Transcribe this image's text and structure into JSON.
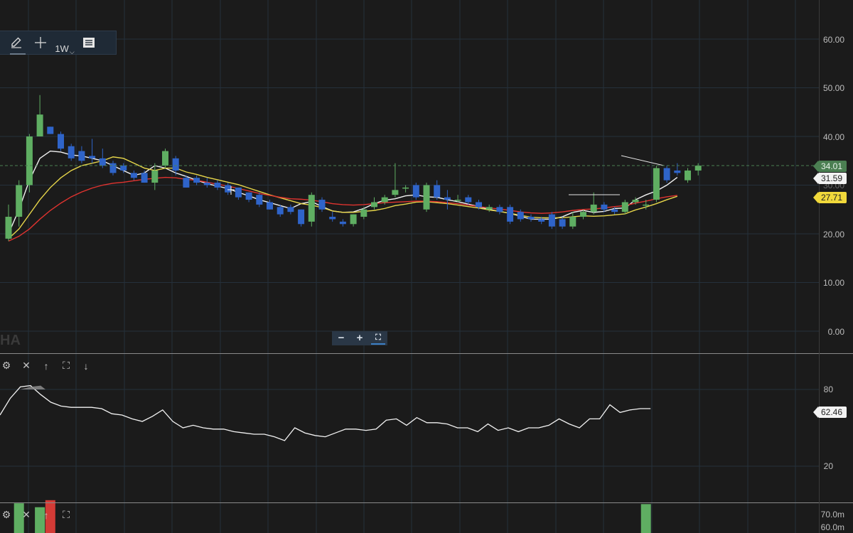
{
  "toolbar": {
    "timeframe": "1W",
    "icons": [
      "pencil-icon",
      "crosshair-icon",
      "chevron-down-icon",
      "list-icon"
    ]
  },
  "zoom": {
    "minus": "−",
    "plus": "+",
    "fit": "⛶"
  },
  "symbol_watermark": "HA",
  "panels": {
    "rsi_tools": [
      "gear-icon",
      "close-icon",
      "arrow-up-icon",
      "expand-icon",
      "arrow-down-icon"
    ],
    "volume_tools": [
      "gear-icon",
      "close-icon",
      "arrow-up-icon",
      "expand-icon"
    ]
  },
  "price_tags": {
    "last": "34.01",
    "white": "31.59",
    "yellow": "27.71",
    "rsi": "62.46"
  },
  "colors": {
    "up": "#5fae62",
    "down": "#2f64c9",
    "sma_white": "#f2f2f2",
    "sma_yellow": "#e7d64a",
    "sma_red": "#e0332f",
    "grid": "#25303b",
    "last_line": "#4b7f52"
  },
  "chart_data": [
    {
      "type": "candlestick",
      "title": "",
      "timeframe": "1W",
      "y_ticks": [
        "60.00",
        "50.00",
        "40.00",
        "30.00",
        "20.00",
        "10.00",
        "0.00"
      ],
      "ylim": [
        -3,
        73
      ],
      "last_price": 34.01,
      "candles": [
        {
          "o": 19.0,
          "h": 26.0,
          "l": 18.5,
          "c": 23.5
        },
        {
          "o": 23.5,
          "h": 31.0,
          "l": 21.5,
          "c": 30.0
        },
        {
          "o": 30.0,
          "h": 40.5,
          "l": 28.5,
          "c": 40.0
        },
        {
          "o": 40.0,
          "h": 48.5,
          "l": 42.0,
          "c": 44.5
        },
        {
          "o": 42.0,
          "h": 42.0,
          "l": 40.5,
          "c": 40.5
        },
        {
          "o": 40.5,
          "h": 41.0,
          "l": 37.0,
          "c": 37.5
        },
        {
          "o": 38.0,
          "h": 38.5,
          "l": 35.0,
          "c": 35.5
        },
        {
          "o": 37.0,
          "h": 38.0,
          "l": 34.5,
          "c": 35.0
        },
        {
          "o": 36.0,
          "h": 39.5,
          "l": 34.5,
          "c": 35.5
        },
        {
          "o": 35.5,
          "h": 37.5,
          "l": 33.5,
          "c": 34.0
        },
        {
          "o": 34.5,
          "h": 35.0,
          "l": 32.0,
          "c": 32.5
        },
        {
          "o": 34.0,
          "h": 34.5,
          "l": 32.5,
          "c": 33.0
        },
        {
          "o": 32.5,
          "h": 33.0,
          "l": 31.0,
          "c": 31.5
        },
        {
          "o": 32.5,
          "h": 33.0,
          "l": 30.5,
          "c": 30.5
        },
        {
          "o": 30.5,
          "h": 34.5,
          "l": 29.0,
          "c": 33.0
        },
        {
          "o": 34.0,
          "h": 37.5,
          "l": 33.5,
          "c": 37.0
        },
        {
          "o": 35.5,
          "h": 36.0,
          "l": 32.0,
          "c": 33.0
        },
        {
          "o": 31.5,
          "h": 32.0,
          "l": 29.5,
          "c": 29.5
        },
        {
          "o": 31.5,
          "h": 32.0,
          "l": 30.0,
          "c": 30.5
        },
        {
          "o": 30.5,
          "h": 31.5,
          "l": 29.5,
          "c": 30.0
        },
        {
          "o": 30.5,
          "h": 31.0,
          "l": 29.0,
          "c": 29.5
        },
        {
          "o": 30.0,
          "h": 30.5,
          "l": 28.0,
          "c": 28.5
        },
        {
          "o": 29.5,
          "h": 29.5,
          "l": 27.0,
          "c": 27.5
        },
        {
          "o": 28.5,
          "h": 28.5,
          "l": 26.5,
          "c": 27.0
        },
        {
          "o": 28.0,
          "h": 28.5,
          "l": 25.5,
          "c": 26.0
        },
        {
          "o": 26.5,
          "h": 27.0,
          "l": 25.0,
          "c": 25.0
        },
        {
          "o": 25.5,
          "h": 26.0,
          "l": 23.5,
          "c": 24.0
        },
        {
          "o": 25.5,
          "h": 26.0,
          "l": 24.0,
          "c": 24.5
        },
        {
          "o": 25.0,
          "h": 25.0,
          "l": 21.5,
          "c": 22.0
        },
        {
          "o": 22.5,
          "h": 28.5,
          "l": 21.5,
          "c": 28.0
        },
        {
          "o": 27.0,
          "h": 27.5,
          "l": 24.5,
          "c": 25.0
        },
        {
          "o": 23.5,
          "h": 24.5,
          "l": 22.5,
          "c": 23.0
        },
        {
          "o": 22.5,
          "h": 23.0,
          "l": 21.5,
          "c": 22.0
        },
        {
          "o": 22.0,
          "h": 24.0,
          "l": 21.5,
          "c": 24.0
        },
        {
          "o": 23.5,
          "h": 25.5,
          "l": 23.0,
          "c": 25.0
        },
        {
          "o": 25.5,
          "h": 27.5,
          "l": 25.0,
          "c": 26.5
        },
        {
          "o": 26.5,
          "h": 28.0,
          "l": 26.0,
          "c": 27.5
        },
        {
          "o": 28.0,
          "h": 34.5,
          "l": 27.5,
          "c": 29.0
        },
        {
          "o": 29.5,
          "h": 30.0,
          "l": 28.5,
          "c": 29.5
        },
        {
          "o": 30.0,
          "h": 30.5,
          "l": 27.0,
          "c": 27.5
        },
        {
          "o": 25.0,
          "h": 30.5,
          "l": 24.5,
          "c": 30.0
        },
        {
          "o": 30.0,
          "h": 31.0,
          "l": 27.0,
          "c": 27.5
        },
        {
          "o": 27.5,
          "h": 29.0,
          "l": 25.0,
          "c": 27.0
        },
        {
          "o": 27.0,
          "h": 28.0,
          "l": 26.5,
          "c": 27.0
        },
        {
          "o": 27.5,
          "h": 28.0,
          "l": 26.0,
          "c": 26.5
        },
        {
          "o": 26.5,
          "h": 27.0,
          "l": 25.0,
          "c": 25.5
        },
        {
          "o": 25.0,
          "h": 26.0,
          "l": 24.5,
          "c": 25.5
        },
        {
          "o": 25.5,
          "h": 26.0,
          "l": 24.0,
          "c": 24.5
        },
        {
          "o": 25.5,
          "h": 26.0,
          "l": 22.0,
          "c": 22.5
        },
        {
          "o": 24.5,
          "h": 25.0,
          "l": 22.5,
          "c": 23.0
        },
        {
          "o": 23.5,
          "h": 24.0,
          "l": 22.5,
          "c": 23.0
        },
        {
          "o": 23.0,
          "h": 23.5,
          "l": 22.0,
          "c": 22.5
        },
        {
          "o": 24.0,
          "h": 24.5,
          "l": 21.0,
          "c": 21.5
        },
        {
          "o": 23.0,
          "h": 23.5,
          "l": 21.0,
          "c": 21.5
        },
        {
          "o": 21.5,
          "h": 24.5,
          "l": 21.0,
          "c": 23.5
        },
        {
          "o": 23.5,
          "h": 25.0,
          "l": 23.0,
          "c": 24.5
        },
        {
          "o": 24.5,
          "h": 28.5,
          "l": 24.0,
          "c": 26.0
        },
        {
          "o": 26.0,
          "h": 26.5,
          "l": 24.5,
          "c": 25.0
        },
        {
          "o": 25.0,
          "h": 25.5,
          "l": 24.0,
          "c": 24.5
        },
        {
          "o": 24.5,
          "h": 27.0,
          "l": 24.0,
          "c": 26.5
        },
        {
          "o": 26.5,
          "h": 27.5,
          "l": 26.0,
          "c": 27.0
        },
        {
          "o": 26.0,
          "h": 27.0,
          "l": 25.0,
          "c": 26.0
        },
        {
          "o": 27.0,
          "h": 34.0,
          "l": 26.5,
          "c": 33.5
        },
        {
          "o": 33.5,
          "h": 34.0,
          "l": 30.5,
          "c": 31.0
        },
        {
          "o": 33.0,
          "h": 34.5,
          "l": 32.0,
          "c": 32.5
        },
        {
          "o": 31.0,
          "h": 33.5,
          "l": 30.5,
          "c": 33.0
        },
        {
          "o": 33.0,
          "h": 34.5,
          "l": 32.0,
          "c": 34.0
        }
      ],
      "series": [
        {
          "color": "#f2f2f2",
          "values": [
            20.0,
            25.0,
            31.0,
            35.5,
            37.0,
            36.8,
            36.2,
            36.0,
            35.5,
            35.0,
            34.0,
            33.0,
            32.0,
            32.5,
            34.0,
            33.5,
            32.5,
            31.8,
            31.0,
            30.3,
            29.8,
            29.3,
            28.5,
            27.8,
            27.0,
            26.4,
            25.8,
            25.2,
            26.2,
            26.6,
            25.6,
            24.7,
            24.4,
            24.5,
            25.2,
            26.2,
            26.9,
            27.2,
            27.8,
            28.0,
            27.6,
            27.5,
            27.0,
            26.6,
            26.1,
            25.6,
            25.0,
            24.6,
            24.2,
            23.6,
            23.0,
            23.0,
            23.0,
            23.5,
            24.4,
            24.8,
            24.4,
            24.6,
            25.2,
            25.3,
            27.0,
            28.0,
            28.8,
            30.0,
            31.59
          ]
        },
        {
          "color": "#e7d64a",
          "values": [
            19.0,
            21.0,
            24.0,
            27.0,
            29.5,
            31.5,
            33.0,
            34.0,
            34.5,
            35.0,
            35.8,
            35.5,
            34.5,
            33.5,
            33.0,
            33.5,
            33.5,
            32.7,
            32.2,
            31.6,
            31.1,
            30.6,
            30.1,
            29.4,
            28.7,
            28.0,
            27.4,
            26.8,
            26.2,
            25.9,
            25.4,
            24.7,
            24.4,
            24.4,
            24.6,
            24.8,
            25.2,
            25.8,
            26.1,
            26.5,
            26.6,
            26.4,
            26.2,
            25.9,
            25.6,
            25.3,
            24.9,
            24.6,
            24.2,
            23.8,
            23.4,
            23.3,
            23.3,
            23.3,
            23.5,
            23.7,
            23.6,
            23.7,
            23.9,
            24.1,
            24.9,
            25.5,
            26.2,
            27.0,
            27.71
          ]
        },
        {
          "color": "#e0332f",
          "values": [
            18.5,
            19.5,
            21.0,
            23.0,
            24.8,
            26.3,
            27.6,
            28.6,
            29.4,
            30.0,
            30.4,
            30.6,
            30.9,
            31.2,
            31.4,
            31.6,
            31.5,
            31.2,
            31.0,
            30.6,
            30.2,
            29.8,
            29.3,
            28.8,
            28.3,
            27.9,
            27.5,
            27.2,
            27.1,
            26.9,
            26.6,
            26.2,
            26.0,
            25.9,
            26.0,
            26.2,
            26.4,
            26.5,
            26.6,
            26.7,
            26.7,
            26.6,
            26.4,
            26.2,
            25.9,
            25.6,
            25.3,
            25.1,
            24.8,
            24.5,
            24.3,
            24.2,
            24.3,
            24.5,
            24.8,
            25.0,
            25.1,
            25.3,
            25.6,
            25.8,
            26.3,
            26.7,
            27.2,
            27.6,
            27.9
          ]
        }
      ]
    },
    {
      "type": "line",
      "title": "",
      "y_ticks": [
        "80",
        "20"
      ],
      "ylim": [
        0,
        100
      ],
      "last_value": 62.46,
      "values": [
        60,
        73,
        82,
        83,
        76,
        70,
        67,
        66,
        66,
        66,
        65,
        61,
        60,
        57,
        55,
        59,
        64,
        55,
        50,
        52,
        50,
        49,
        49,
        47,
        46,
        45,
        45,
        43,
        40,
        50,
        46,
        44,
        43,
        46,
        49,
        49,
        48,
        49,
        56,
        57,
        52,
        58,
        54,
        54,
        53,
        50,
        50,
        47,
        53,
        48,
        50,
        47,
        50,
        50,
        52,
        57,
        53,
        50,
        57,
        57,
        68,
        62,
        64,
        65,
        65
      ]
    },
    {
      "type": "bar",
      "title": "",
      "y_ticks": [
        "70.0m",
        "60.0m"
      ],
      "bars": [
        {
          "index": 1,
          "value": 76,
          "color": "#5fae62"
        },
        {
          "index": 3,
          "value": 66,
          "color": "#5fae62"
        },
        {
          "index": 4,
          "value": 84,
          "color": "#d33b36"
        },
        {
          "index": 61,
          "value": 74,
          "color": "#5fae62"
        }
      ]
    }
  ]
}
